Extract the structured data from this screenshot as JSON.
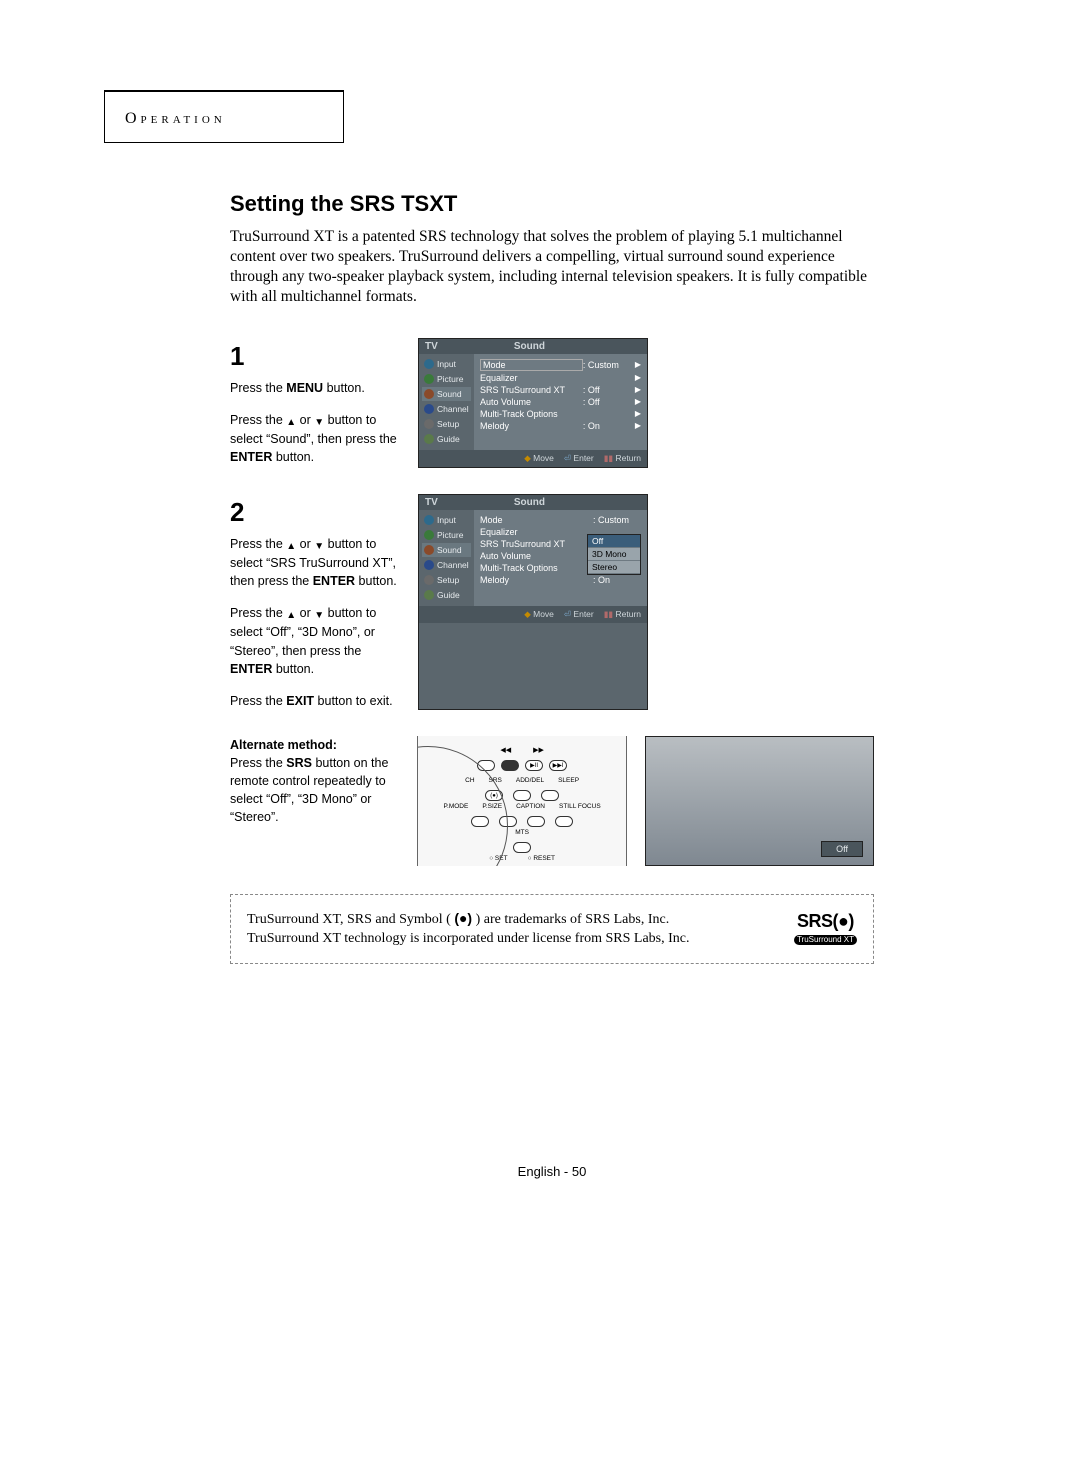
{
  "section_header": "Operation",
  "title": "Setting the SRS TSXT",
  "intro": "TruSurround XT is a patented SRS technology that solves the problem of playing 5.1 multichannel content over two speakers. TruSurround delivers a compelling, virtual surround sound experience through any two-speaker playback system, including internal television speakers. It is fully compatible with all multichannel formats.",
  "steps": {
    "s1": {
      "num": "1",
      "para1_a": "Press the ",
      "para1_bold": "MENU",
      "para1_b": " button.",
      "para2_a": "Press the ",
      "para2_mid": " button to select “Sound”, then press the ",
      "para2_bold": "ENTER",
      "para2_b": " button."
    },
    "s2": {
      "num": "2",
      "para1_a": "Press the ",
      "para1_mid": " button to select “SRS TruSurround XT”, then press the ",
      "para1_bold": "ENTER",
      "para1_b": " button.",
      "para2_a": "Press the ",
      "para2_mid": " button to select “Off”, “3D Mono”, or “Stereo”, then press the ",
      "para2_bold": "ENTER",
      "para2_b": " button.",
      "para3_a": "Press the ",
      "para3_bold": "EXIT",
      "para3_b": " button to exit."
    }
  },
  "or_sep": " or ",
  "osd": {
    "tv": "TV",
    "sound": "Sound",
    "sidebar": [
      "Input",
      "Picture",
      "Sound",
      "Channel",
      "Setup",
      "Guide"
    ],
    "rows": {
      "mode": "Mode",
      "mode_val": ": Custom",
      "equalizer": "Equalizer",
      "srs": "SRS TruSurround XT",
      "srs_val": ": Off",
      "autovol": "Auto Volume",
      "autovol_val": ": Off",
      "mto": "Multi-Track Options",
      "melody": "Melody",
      "melody_val": ": On"
    },
    "footer": {
      "move": "Move",
      "enter": "Enter",
      "return": "Return"
    },
    "options": [
      "Off",
      "3D Mono",
      "Stereo"
    ]
  },
  "alt": {
    "heading": "Alternate method:",
    "text_a": "Press the ",
    "text_bold": "SRS",
    "text_b": " button on the remote control repeatedly to select “Off”, “3D Mono”  or “Stereo”."
  },
  "remote": {
    "labels_top": [
      "SRS",
      "ADD/DEL",
      "SLEEP"
    ],
    "labels_bot": [
      "P.MODE",
      "P.SIZE",
      "CAPTION",
      "STILL FOCUS"
    ],
    "mts": "MTS",
    "set": "SET",
    "reset": "RESET",
    "ch": "CH"
  },
  "mini_osd_label": "Off",
  "trademark": {
    "line1_a": "TruSurround XT, SRS and Symbol ( ",
    "line1_b": " ) are trademarks of SRS Labs, Inc.",
    "line2": "TruSurround XT technology is incorporated under license from SRS Labs, Inc."
  },
  "srs_logo": {
    "top": "SRS(●)",
    "bot": "TruSurround XT"
  },
  "page_footer": "English - 50"
}
